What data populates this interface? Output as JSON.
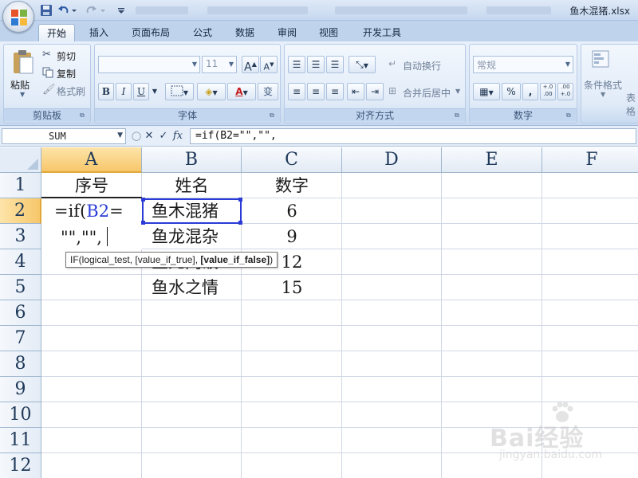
{
  "window": {
    "title": "鱼木混猪.xlsx"
  },
  "ribbon_tabs": [
    "开始",
    "插入",
    "页面布局",
    "公式",
    "数据",
    "审阅",
    "视图",
    "开发工具"
  ],
  "clipboard": {
    "paste": "粘贴",
    "cut": "剪切",
    "copy": "复制",
    "format_painter": "格式刷",
    "label": "剪贴板"
  },
  "font": {
    "name_value": "",
    "size_value": "11",
    "bold": "B",
    "italic": "I",
    "underline": "U",
    "phonetic": "变",
    "label": "字体"
  },
  "alignment": {
    "wrap_text": "自动换行",
    "merge_center": "合并后居中",
    "label": "对齐方式"
  },
  "number": {
    "format_value": "常规",
    "percent": "%",
    "comma": ",",
    "inc_decimal": "+.0 .00",
    "dec_decimal": ".00 +.0",
    "label": "数字"
  },
  "styles": {
    "conditional_format": "条件格式",
    "table_format": "表格"
  },
  "formula_bar": {
    "name_box": "SUM",
    "formula": "=if(B2=\"\",\"\","
  },
  "columns": [
    "A",
    "B",
    "C",
    "D",
    "E",
    "F"
  ],
  "rows": [
    "1",
    "2",
    "3",
    "4",
    "5",
    "6",
    "7",
    "8",
    "9",
    "10",
    "11",
    "12"
  ],
  "cells": {
    "A1": "序号",
    "B1": "姓名",
    "C1": "数字",
    "B2": "鱼木混猪",
    "C2": "6",
    "B3": "鱼龙混杂",
    "C3": "9",
    "B4": "鱼死网破",
    "C4": "12",
    "B5": "鱼水之情",
    "C5": "15"
  },
  "editing": {
    "line1_prefix": "=if(",
    "line1_ref": "B2",
    "line1_suffix": "=",
    "line2": "\"\",\"\","
  },
  "tooltip": {
    "prefix": "IF(logical_test, [value_if_true], ",
    "active_arg": "[value_if_false]",
    "suffix": ")"
  },
  "watermark": {
    "brand": "Bai经验",
    "url": "jingyan.baidu.com"
  }
}
